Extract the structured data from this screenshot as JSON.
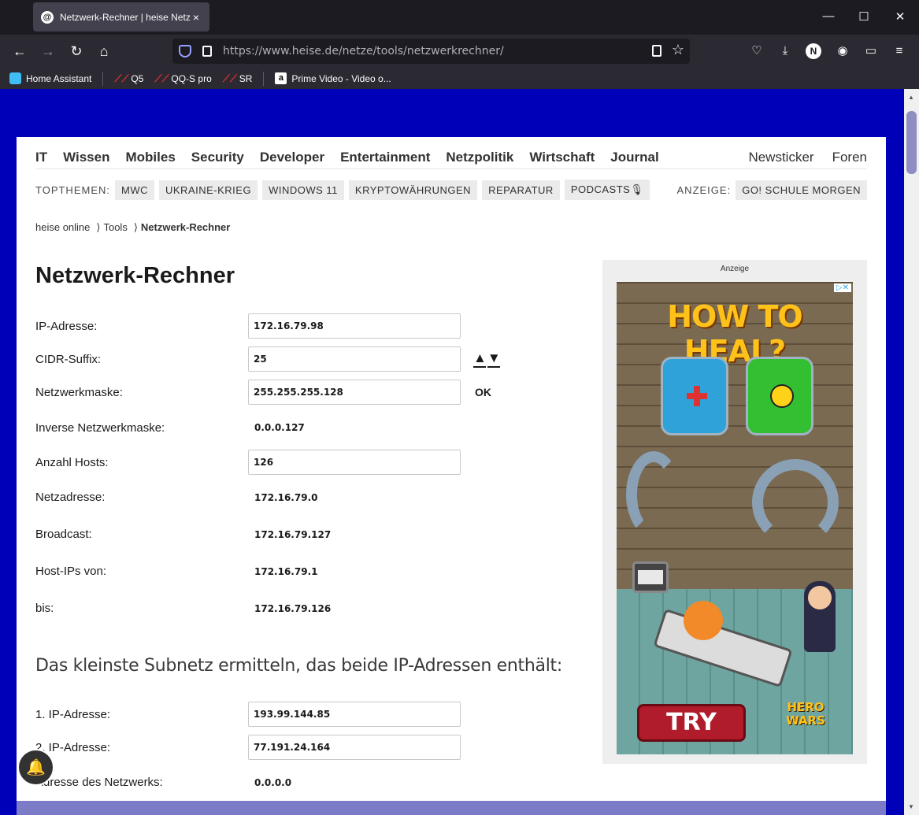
{
  "browser": {
    "tab_title": "Netzwerk-Rechner | heise Netze",
    "tab_close": "×",
    "url_host": "https://www.heise.de",
    "url_path": "/netze/tools/netzwerkrechner/",
    "bookmarks": [
      {
        "label": "Home Assistant"
      },
      {
        "label": "Q5"
      },
      {
        "label": "QQ-S pro"
      },
      {
        "label": "SR"
      },
      {
        "label": "Prime Video - Video o..."
      }
    ],
    "profile_initial": "N"
  },
  "colors": {
    "page_background": "#0000b8",
    "browser_dark": "#1c1b22",
    "chip_background": "#ebebeb"
  },
  "nav": {
    "items": [
      "IT",
      "Wissen",
      "Mobiles",
      "Security",
      "Developer",
      "Entertainment",
      "Netzpolitik",
      "Wirtschaft",
      "Journal"
    ],
    "right": [
      "Newsticker",
      "Foren"
    ]
  },
  "topthemen": {
    "label": "TOPTHEMEN:",
    "chips": [
      "MWC",
      "UKRAINE-KRIEG",
      "WINDOWS 11",
      "KRYPTOWÄHRUNGEN",
      "REPARATUR",
      "PODCASTS🎙"
    ],
    "anzeige_label": "ANZEIGE:",
    "anzeige_chip": "GO! SCHULE MORGEN"
  },
  "breadcrumb": {
    "home": "heise online",
    "sep": "⟩",
    "tools": "Tools",
    "current": "Netzwerk-Rechner"
  },
  "calculator": {
    "title": "Netzwerk-Rechner",
    "ip_label": "IP-Adresse:",
    "ip_value": "172.16.79.98",
    "cidr_label": "CIDR-Suffix:",
    "cidr_value": "25",
    "stepper_up": "▲",
    "stepper_down": "▼",
    "mask_label": "Netzwerkmaske:",
    "mask_value": "255.255.255.128",
    "ok_label": "OK",
    "inverse_label": "Inverse Netzwerkmaske:",
    "inverse_value": "0.0.0.127",
    "hosts_label": "Anzahl Hosts:",
    "hosts_value": "126",
    "net_label": "Netzadresse:",
    "net_value": "172.16.79.0",
    "broadcast_label": "Broadcast:",
    "broadcast_value": "172.16.79.127",
    "from_label": "Host-IPs von:",
    "from_value": "172.16.79.1",
    "to_label": "bis:",
    "to_value": "172.16.79.126"
  },
  "subnet": {
    "heading": "Das kleinste Subnetz ermitteln, das beide IP-Adressen enthält:",
    "ip1_label": "1. IP-Adresse:",
    "ip1_value": "193.99.144.85",
    "ip2_label": "2. IP-Adresse:",
    "ip2_value": "77.191.24.164",
    "net_label": "Adresse des Netzwerks:",
    "net_value": "0.0.0.0"
  },
  "ad": {
    "label": "Anzeige",
    "headline": "HOW TO HEAL?",
    "cta": "TRY",
    "logo": "HERO WARS",
    "choices_icon": "▷✕"
  },
  "icons": {
    "back": "back-arrow-icon",
    "forward": "forward-arrow-icon",
    "reload": "reload-icon",
    "home": "home-icon",
    "bell": "notification-bell-icon"
  }
}
